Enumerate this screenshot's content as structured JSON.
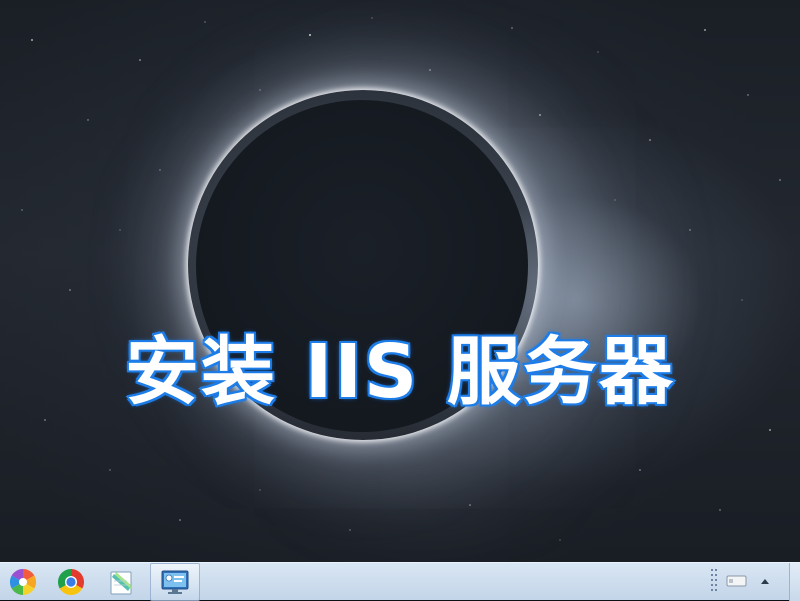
{
  "wallpaper": {
    "headline": "安装 IIS 服务器",
    "headline_stroke_color": "#2a8df0"
  },
  "taskbar": {
    "start_icon": "start-orb-icon",
    "pinned": [
      {
        "name": "pinwheel-app-icon"
      },
      {
        "name": "chrome-icon"
      },
      {
        "name": "notepad-icon"
      },
      {
        "name": "network-monitor-icon"
      }
    ],
    "tray_icons": [
      "notification-grip-icon",
      "tray-device-icon",
      "show-hidden-icons-arrow"
    ]
  }
}
